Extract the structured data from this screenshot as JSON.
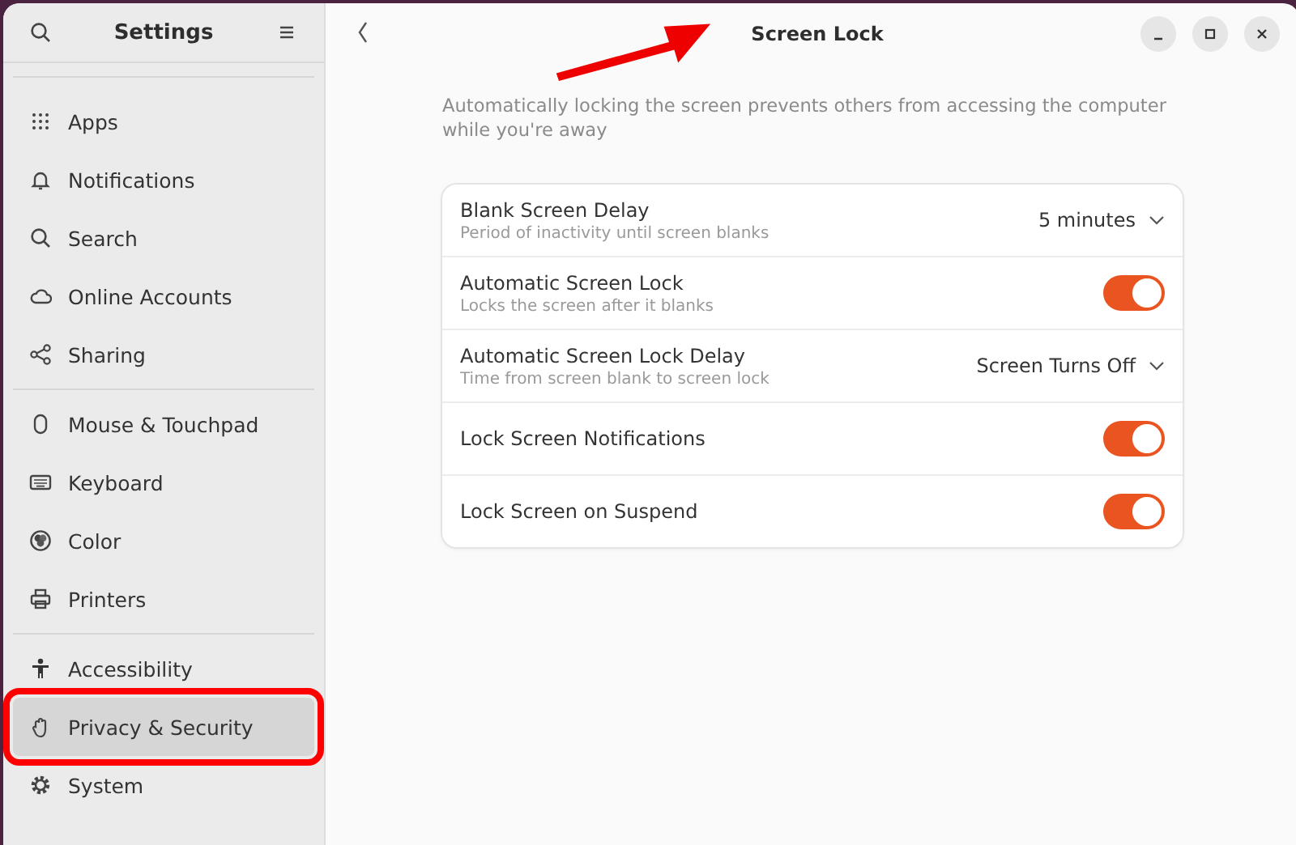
{
  "sidebar": {
    "title": "Settings",
    "groups": [
      {
        "items": [
          {
            "label": "Apps",
            "selected": false
          },
          {
            "label": "Notifications",
            "selected": false
          },
          {
            "label": "Search",
            "selected": false
          },
          {
            "label": "Online Accounts",
            "selected": false
          },
          {
            "label": "Sharing",
            "selected": false
          }
        ]
      },
      {
        "items": [
          {
            "label": "Mouse & Touchpad",
            "selected": false
          },
          {
            "label": "Keyboard",
            "selected": false
          },
          {
            "label": "Color",
            "selected": false
          },
          {
            "label": "Printers",
            "selected": false
          }
        ]
      },
      {
        "items": [
          {
            "label": "Accessibility",
            "selected": false
          },
          {
            "label": "Privacy & Security",
            "selected": true,
            "highlighted": true
          },
          {
            "label": "System",
            "selected": false
          }
        ]
      }
    ]
  },
  "page": {
    "title": "Screen Lock",
    "title_arrow": true,
    "description": "Automatically locking the screen prevents others from accessing the computer while you're away",
    "rows": [
      {
        "kind": "dropdown",
        "title": "Blank Screen Delay",
        "subtitle": "Period of inactivity until screen blanks",
        "value": "5 minutes"
      },
      {
        "kind": "toggle",
        "title": "Automatic Screen Lock",
        "subtitle": "Locks the screen after it blanks",
        "on": true
      },
      {
        "kind": "dropdown",
        "title": "Automatic Screen Lock Delay",
        "subtitle": "Time from screen blank to screen lock",
        "value": "Screen Turns Off"
      },
      {
        "kind": "toggle",
        "title": "Lock Screen Notifications",
        "on": true
      },
      {
        "kind": "toggle",
        "title": "Lock Screen on Suspend",
        "on": true
      }
    ]
  }
}
